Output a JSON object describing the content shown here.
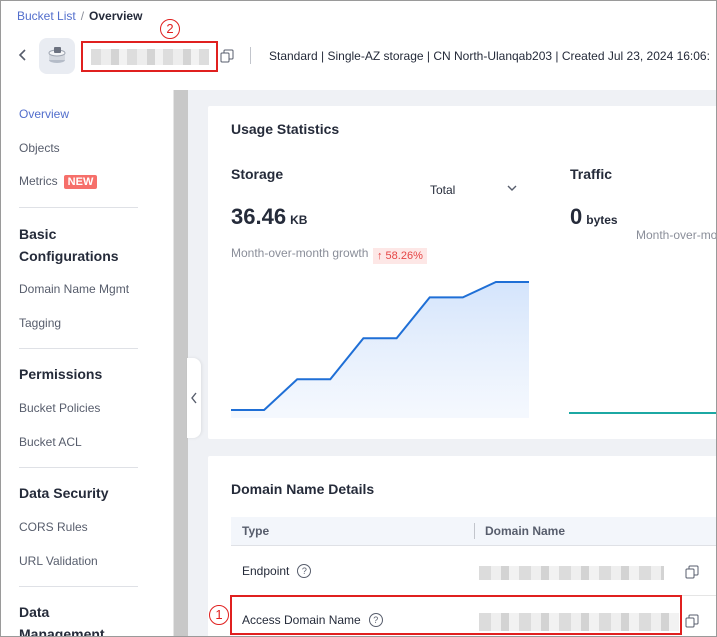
{
  "breadcrumb": {
    "parent": "Bucket List",
    "separator": "/",
    "current": "Overview"
  },
  "header": {
    "meta": "Standard | Single-AZ storage | CN North-Ulanqab203 | Created  Jul 23, 2024 16:06:",
    "callout_name": "2"
  },
  "sidebar": {
    "overview": "Overview",
    "objects": "Objects",
    "metrics": "Metrics",
    "metrics_badge": "NEW",
    "basic_config": "Basic Configurations",
    "domain_mgmt": "Domain Name Mgmt",
    "tagging": "Tagging",
    "permissions": "Permissions",
    "bucket_policies": "Bucket Policies",
    "bucket_acl": "Bucket ACL",
    "data_security": "Data Security",
    "cors_rules": "CORS Rules",
    "url_validation": "URL Validation",
    "data_management": "Data Management"
  },
  "usage": {
    "title": "Usage Statistics",
    "storage_label": "Storage",
    "storage_filter": "Total",
    "storage_value": "36.46",
    "storage_unit": "KB",
    "growth_label": "Month-over-month growth",
    "growth_value": "↑ 58.26%",
    "traffic_label": "Traffic",
    "traffic_value": "0",
    "traffic_unit": "bytes",
    "traffic_growth_label": "Month-over-mo"
  },
  "chart_data": {
    "type": "area",
    "title": "",
    "xlabel": "",
    "ylabel": "",
    "series": [
      {
        "values": [
          0.0,
          0.0,
          0.24,
          0.24,
          0.56,
          0.56,
          0.88,
          0.88,
          1.0,
          1.0
        ]
      }
    ],
    "grid": false
  },
  "domain": {
    "title": "Domain Name Details",
    "col_type": "Type",
    "col_domain": "Domain Name",
    "rows": [
      {
        "type": "Endpoint"
      },
      {
        "type": "Access Domain Name"
      }
    ],
    "callout": "1"
  },
  "colors": {
    "accent": "#526ecc",
    "highlight": "#e0201f",
    "chart_line": "#1f6fd6",
    "traffic_line": "#1ca8a3"
  }
}
